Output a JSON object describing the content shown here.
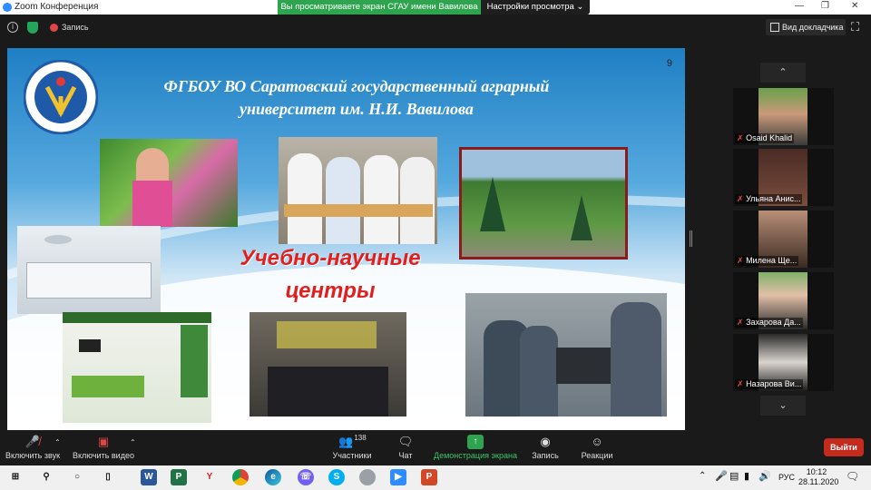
{
  "window": {
    "title": "Zoom Конференция"
  },
  "banner": {
    "share_text": "Вы просматриваете экран СГАУ имени Вавилова",
    "view_settings": "Настройки просмотра"
  },
  "topbar": {
    "record_label": "Запись",
    "speaker_view": "Вид докладчика"
  },
  "slide": {
    "page_number": "9",
    "title_line1": "ФГБОУ ВО Саратовский государственный аграрный",
    "title_line2": "университет им. Н.И. Вавилова",
    "center_text_line1": "Учебно-научные",
    "center_text_line2": "центры"
  },
  "participants": [
    {
      "name": "Osaid Khalid"
    },
    {
      "name": "Ульяна Анис..."
    },
    {
      "name": "Милена Ще..."
    },
    {
      "name": "Захарова Да..."
    },
    {
      "name": "Назарова Ви..."
    }
  ],
  "controls": {
    "mute": "Включить звук",
    "video": "Включить видео",
    "participants": "Участники",
    "participants_count": "138",
    "chat": "Чат",
    "share": "Демонстрация экрана",
    "record": "Запись",
    "reactions": "Реакции",
    "leave": "Выйти"
  },
  "taskbar": {
    "lang": "РУС",
    "time": "10:12",
    "date": "28.11.2020"
  },
  "colors": {
    "share_green": "#2ea44f",
    "leave_red": "#c42b1c",
    "slide_title_blue": "#ffffff",
    "center_text_red": "#e0201e"
  }
}
